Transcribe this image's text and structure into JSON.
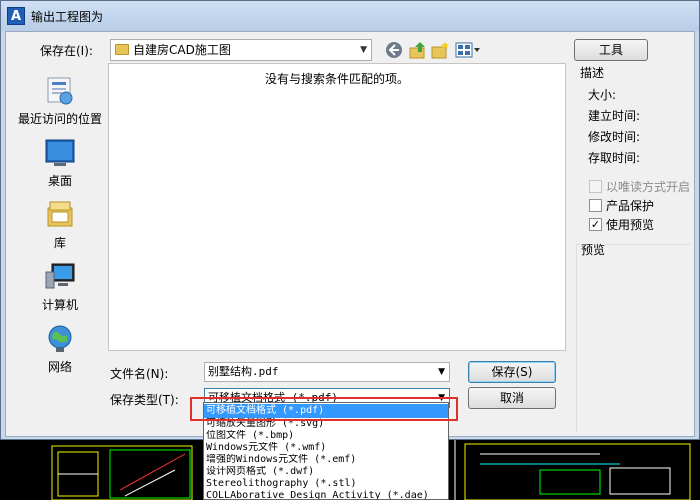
{
  "window": {
    "title": "输出工程图为",
    "app_icon": "A"
  },
  "save_in": {
    "label": "保存在(I):",
    "value": "自建房CAD施工图"
  },
  "toolbar": {
    "back_icon": "back-icon",
    "up_icon": "up-folder-icon",
    "new_folder_icon": "new-folder-icon",
    "view_icon": "view-menu-icon"
  },
  "places": [
    {
      "label": "最近访问的位置",
      "icon": "recent-places-icon"
    },
    {
      "label": "桌面",
      "icon": "desktop-icon"
    },
    {
      "label": "库",
      "icon": "libraries-icon"
    },
    {
      "label": "计算机",
      "icon": "computer-icon"
    },
    {
      "label": "网络",
      "icon": "network-icon"
    }
  ],
  "file_list": {
    "empty_message": "没有与搜索条件匹配的项。"
  },
  "right_panel": {
    "tools_label": "工具",
    "description": {
      "title": "描述",
      "fields": [
        "大小:",
        "建立时间:",
        "修改时间:",
        "存取时间:"
      ]
    },
    "options": [
      {
        "label": "以唯读方式开启",
        "checked": false,
        "disabled": true
      },
      {
        "label": "产品保护",
        "checked": false,
        "disabled": false
      },
      {
        "label": "使用预览",
        "checked": true,
        "disabled": false
      }
    ],
    "preview_title": "预览"
  },
  "filename": {
    "label": "文件名(N):",
    "value": "别墅结构.pdf"
  },
  "filetype": {
    "label": "保存类型(T):",
    "value": "可移植文档格式 (*.pdf)",
    "options": [
      "可移植文档格式 (*.pdf)",
      "可缩放矢量图形 (*.svg)",
      "位图文件 (*.bmp)",
      "Windows元文件 (*.wmf)",
      "增强的Windows元文件 (*.emf)",
      "设计网页格式 (*.dwf)",
      "Stereolithography (*.stl)",
      "COLLAborative Design Activity (*.dae)"
    ],
    "selected_index": 0
  },
  "buttons": {
    "save": "保存(S)",
    "cancel": "取消"
  },
  "colors": {
    "selection": "#3399ff",
    "highlight_box": "#e0302a",
    "title_bar": "#c9d9ec"
  }
}
